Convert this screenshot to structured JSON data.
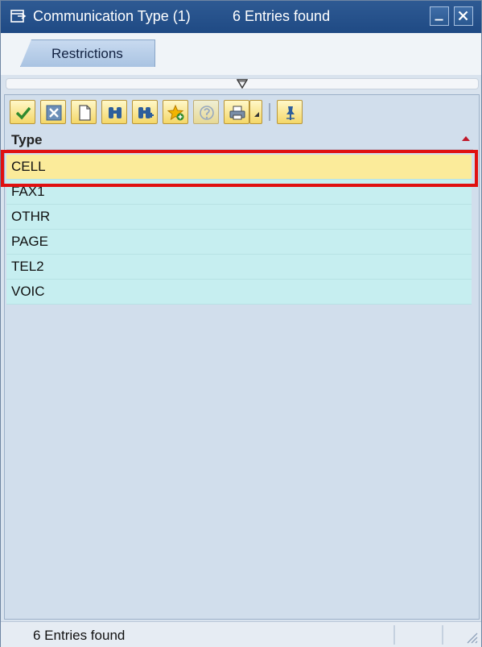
{
  "window": {
    "title": "Communication Type (1)",
    "entries_label": "6 Entries found",
    "title_icon": "popup-window-icon",
    "controls": [
      "minimize-icon",
      "close-icon"
    ]
  },
  "tabs": [
    {
      "label": "Restrictions"
    }
  ],
  "toolbar": {
    "buttons": [
      "checkmark-icon",
      "cancel-icon",
      "new-document-icon",
      "find-icon",
      "find-next-icon",
      "favorites-add-icon",
      "help-icon",
      "print-icon",
      "dropdown-arrow-icon",
      "pin-icon"
    ]
  },
  "table": {
    "column_header": "Type",
    "rows": [
      "CELL",
      "FAX1",
      "OTHR",
      "PAGE",
      "TEL2",
      "VOIC"
    ],
    "selected_row": "CELL"
  },
  "status": {
    "text": "6 Entries found"
  },
  "colors": {
    "title_bar": "#1f4a84",
    "row_background": "#c6eef0",
    "selected_row": "#fbeb9a",
    "highlight_border": "#e01010"
  }
}
